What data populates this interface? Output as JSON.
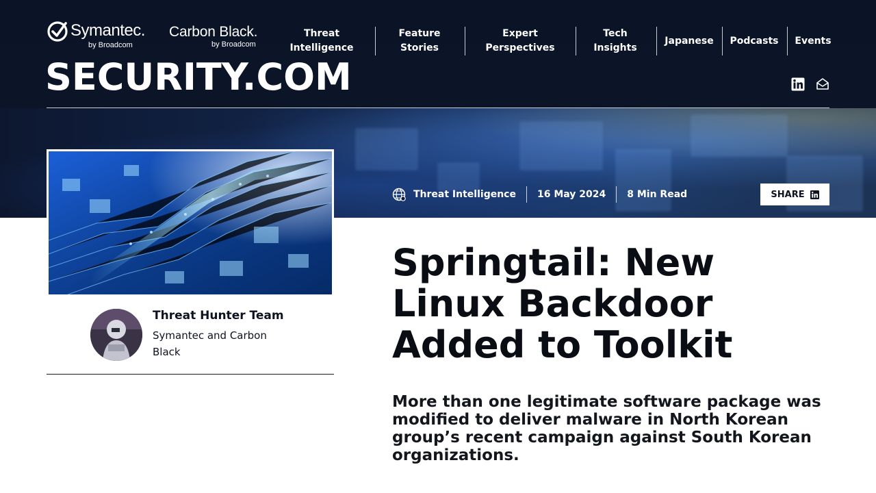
{
  "header": {
    "symantec_logo": {
      "name": "Symantec.",
      "byline": "by Broadcom"
    },
    "carbonblack_logo": {
      "name": "Carbon Black.",
      "byline": "by Broadcom"
    },
    "brand": "SECURITY.COM",
    "nav": [
      {
        "label": "Threat Intelligence"
      },
      {
        "label": "Feature Stories"
      },
      {
        "label": "Expert Perspectives"
      },
      {
        "label": "Tech Insights"
      },
      {
        "label": "Japanese"
      },
      {
        "label": "Podcasts"
      },
      {
        "label": "Events"
      }
    ],
    "social": [
      {
        "icon": "linkedin-icon"
      },
      {
        "icon": "mail-icon"
      }
    ]
  },
  "article": {
    "meta": {
      "category": "Threat Intelligence",
      "category_icon": "globe-icon",
      "date": "16 May 2024",
      "read_time": "8 Min Read"
    },
    "share_label": "SHARE",
    "title": "Springtail: New Linux Backdoor Added to Toolkit",
    "deck": "More than one legitimate software package was modified to deliver malware in North Korean group’s recent campaign against South Korean organizations.",
    "author": {
      "name": "Threat Hunter Team",
      "org": "Symantec and Carbon Black"
    }
  },
  "colors": {
    "header_bg": "#0b1326",
    "text_dark": "#0b0d14",
    "white": "#ffffff"
  }
}
